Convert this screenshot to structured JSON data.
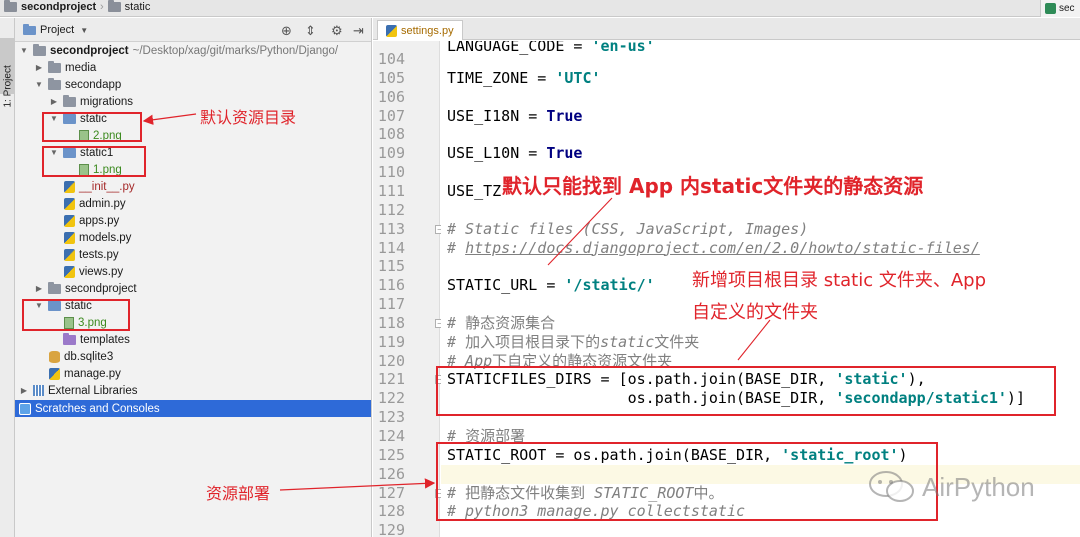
{
  "breadcrumb": {
    "project": "secondproject",
    "folder": "static"
  },
  "right_tab": {
    "label": "sec"
  },
  "tool_strip": {
    "label": "1: Project"
  },
  "project_panel": {
    "title": "Project",
    "tree": [
      {
        "label": "secondproject",
        "path": "~/Desktop/xag/git/marks/Python/Django/",
        "kind": "folder",
        "state": "open",
        "bold": true
      },
      {
        "label": "media",
        "kind": "folder",
        "state": "closed"
      },
      {
        "label": "secondapp",
        "kind": "folder",
        "state": "open"
      },
      {
        "label": "migrations",
        "kind": "folder",
        "state": "closed"
      },
      {
        "label": "static",
        "kind": "folder",
        "state": "open"
      },
      {
        "label": "2.png",
        "kind": "png"
      },
      {
        "label": "static1",
        "kind": "folder",
        "state": "open"
      },
      {
        "label": "1.png",
        "kind": "png"
      },
      {
        "label": "__init__.py",
        "kind": "py"
      },
      {
        "label": "admin.py",
        "kind": "py"
      },
      {
        "label": "apps.py",
        "kind": "py"
      },
      {
        "label": "models.py",
        "kind": "py"
      },
      {
        "label": "tests.py",
        "kind": "py"
      },
      {
        "label": "views.py",
        "kind": "py"
      },
      {
        "label": "secondproject",
        "kind": "folder",
        "state": "closed"
      },
      {
        "label": "static",
        "kind": "folder",
        "state": "open"
      },
      {
        "label": "3.png",
        "kind": "png"
      },
      {
        "label": "templates",
        "kind": "folder"
      },
      {
        "label": "db.sqlite3",
        "kind": "db"
      },
      {
        "label": "manage.py",
        "kind": "py"
      },
      {
        "label": "External Libraries",
        "kind": "libs",
        "state": "closed"
      },
      {
        "label": "Scratches and Consoles",
        "kind": "scratch",
        "selected": true
      }
    ]
  },
  "editor": {
    "tab": "settings.py",
    "lines": [
      {
        "n": "104",
        "code": ""
      },
      {
        "n": "105",
        "code": "TIME_ZONE = 'UTC'"
      },
      {
        "n": "106",
        "code": ""
      },
      {
        "n": "107",
        "code": "USE_I18N = True"
      },
      {
        "n": "108",
        "code": ""
      },
      {
        "n": "109",
        "code": "USE_L10N = True"
      },
      {
        "n": "110",
        "code": ""
      },
      {
        "n": "111",
        "code": "USE_TZ"
      },
      {
        "n": "112",
        "code": ""
      },
      {
        "n": "113",
        "code": "# Static files (CSS, JavaScript, Images)"
      },
      {
        "n": "114",
        "code": "# https://docs.djangoproject.com/en/2.0/howto/static-files/"
      },
      {
        "n": "115",
        "code": ""
      },
      {
        "n": "116",
        "code": "STATIC_URL = '/static/'"
      },
      {
        "n": "117",
        "code": ""
      },
      {
        "n": "118",
        "code": "# 静态资源集合"
      },
      {
        "n": "119",
        "code": "# 加入项目根目录下的static文件夹"
      },
      {
        "n": "120",
        "code": "# App下自定义的静态资源文件夹"
      },
      {
        "n": "121",
        "code": "STATICFILES_DIRS = [os.path.join(BASE_DIR, 'static'),"
      },
      {
        "n": "122",
        "code": "                    os.path.join(BASE_DIR, 'secondapp/static1')]"
      },
      {
        "n": "123",
        "code": ""
      },
      {
        "n": "124",
        "code": "# 资源部署"
      },
      {
        "n": "125",
        "code": "STATIC_ROOT = os.path.join(BASE_DIR, 'static_root')"
      },
      {
        "n": "126",
        "code": ""
      },
      {
        "n": "127",
        "code": "# 把静态文件收集到 STATIC_ROOT中。"
      },
      {
        "n": "128",
        "code": "# python3 manage.py collectstatic"
      },
      {
        "n": "129",
        "code": ""
      }
    ],
    "partial_top_line": "LANGUAGE_CODE = 'en-us'"
  },
  "annotations": {
    "default_dir": "默认资源目录",
    "only_app_static": "默认只能找到 App 内static文件夹的静态资源",
    "new_dirs_line1": "新增项目根目录 static 文件夹、App",
    "new_dirs_line2": "自定义的文件夹",
    "deploy": "资源部署"
  },
  "watermark": {
    "text": "AirPython"
  },
  "colors": {
    "annotation_red": "#e0242b",
    "selection_blue": "#2e6ad8",
    "keyword": "#000080",
    "string": "#008080",
    "comment": "#808080"
  }
}
